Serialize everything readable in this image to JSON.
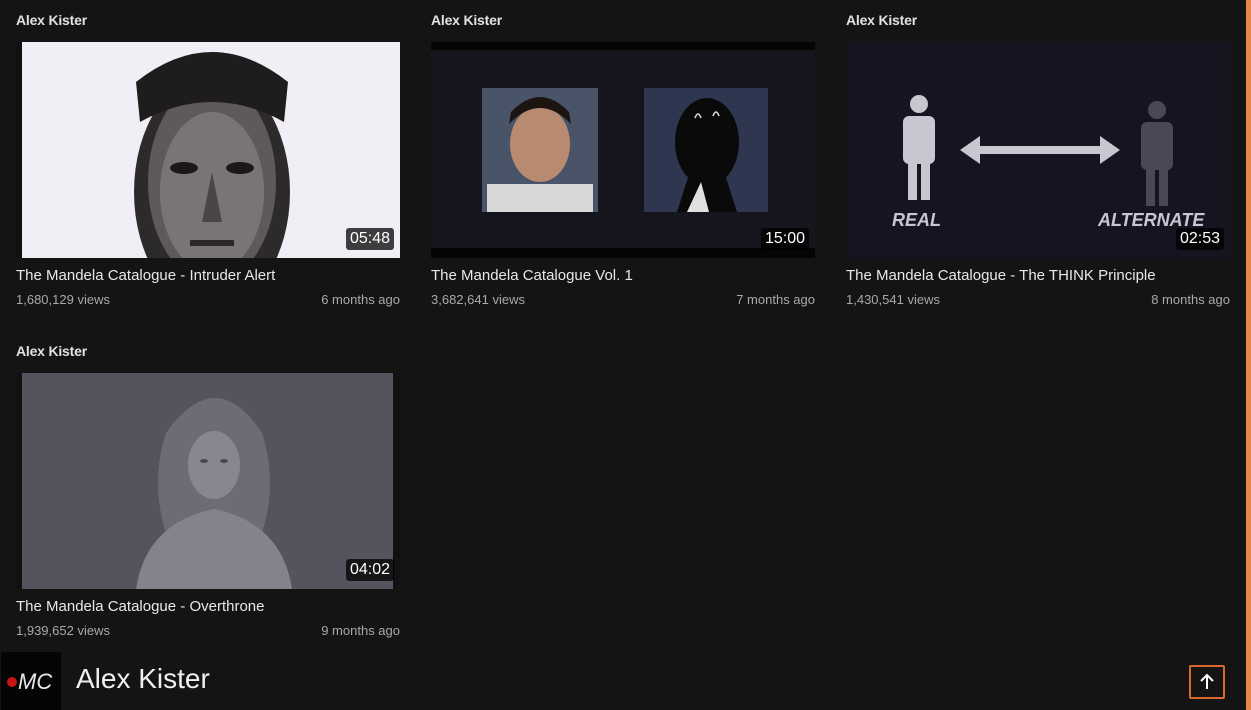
{
  "videos": [
    {
      "channel": "Alex Kister",
      "title": "The Mandela Catalogue - Intruder Alert",
      "views": "1,680,129 views",
      "age": "6 months ago",
      "duration": "05:48"
    },
    {
      "channel": "Alex Kister",
      "title": "The Mandela Catalogue Vol. 1",
      "views": "3,682,641 views",
      "age": "7 months ago",
      "duration": "15:00"
    },
    {
      "channel": "Alex Kister",
      "title": "The Mandela Catalogue - The THINK Principle",
      "views": "1,430,541 views",
      "age": "8 months ago",
      "duration": "02:53",
      "thumb_text_left": "REAL",
      "thumb_text_right": "ALTERNATE"
    },
    {
      "channel": "Alex Kister",
      "title": "The Mandela Catalogue - Overthrone",
      "views": "1,939,652 views",
      "age": "9 months ago",
      "duration": "04:02"
    }
  ],
  "footer": {
    "logo_text": "MC",
    "channel_name": "Alex Kister",
    "scroll_top_icon": "arrow-up-icon"
  },
  "colors": {
    "background": "#141414",
    "accent": "#e6864a",
    "logo_dot": "#c81414"
  }
}
